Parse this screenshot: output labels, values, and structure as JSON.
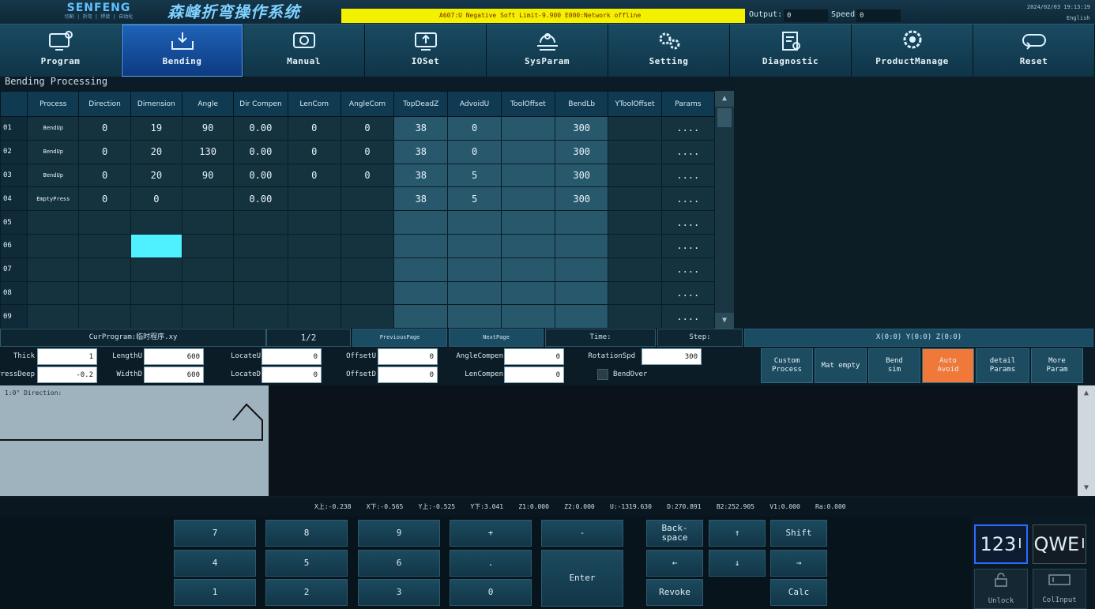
{
  "header": {
    "brand": "SENFENG",
    "brand_sub": "切割 | 折弯 | 焊接 | 自动化",
    "system_title": "森峰折弯操作系统",
    "alarm_text": "A607:U Negative Soft Limit-9.900    E000:Network offline",
    "output_label": "Output:",
    "output_value": "0",
    "speed_label": "Speed:",
    "speed_value": "0",
    "datetime": "2024/02/03 19:13:19",
    "lang": "English"
  },
  "nav": [
    {
      "label": "Program",
      "icon": "program-icon"
    },
    {
      "label": "Bending",
      "icon": "bending-icon",
      "active": true
    },
    {
      "label": "Manual",
      "icon": "manual-icon"
    },
    {
      "label": "IOSet",
      "icon": "ioset-icon"
    },
    {
      "label": "SysParam",
      "icon": "sysparam-icon"
    },
    {
      "label": "Setting",
      "icon": "setting-icon"
    },
    {
      "label": "Diagnostic",
      "icon": "diagnostic-icon"
    },
    {
      "label": "ProductManage",
      "icon": "productmanage-icon"
    },
    {
      "label": "Reset",
      "icon": "reset-icon"
    }
  ],
  "section_title": "Bending Processing",
  "table": {
    "columns": [
      "Process",
      "Direction",
      "Dimension",
      "Angle",
      "Dir Compen",
      "LenCom",
      "AngleCom",
      "TopDeadZ",
      "AdvoidU",
      "ToolOffset",
      "BendLb",
      "YToolOffset",
      "Params"
    ],
    "rows": [
      {
        "no": "01",
        "cells": [
          "BendUp",
          "0",
          "19",
          "90",
          "0.00",
          "0",
          "0",
          "38",
          "0",
          "",
          "300",
          "",
          "...."
        ]
      },
      {
        "no": "02",
        "cells": [
          "BendUp",
          "0",
          "20",
          "130",
          "0.00",
          "0",
          "0",
          "38",
          "0",
          "",
          "300",
          "",
          "...."
        ]
      },
      {
        "no": "03",
        "cells": [
          "BendUp",
          "0",
          "20",
          "90",
          "0.00",
          "0",
          "0",
          "38",
          "5",
          "",
          "300",
          "",
          "...."
        ]
      },
      {
        "no": "04",
        "cells": [
          "EmptyPress",
          "0",
          "0",
          "",
          "0.00",
          "",
          "",
          "38",
          "5",
          "",
          "300",
          "",
          "...."
        ]
      },
      {
        "no": "05",
        "cells": [
          "",
          "",
          "",
          "",
          "",
          "",
          "",
          "",
          "",
          "",
          "",
          "",
          "...."
        ]
      },
      {
        "no": "06",
        "cells": [
          "",
          "",
          "",
          "",
          "",
          "",
          "",
          "",
          "",
          "",
          "",
          "",
          "...."
        ]
      },
      {
        "no": "07",
        "cells": [
          "",
          "",
          "",
          "",
          "",
          "",
          "",
          "",
          "",
          "",
          "",
          "",
          "...."
        ]
      },
      {
        "no": "08",
        "cells": [
          "",
          "",
          "",
          "",
          "",
          "",
          "",
          "",
          "",
          "",
          "",
          "",
          "...."
        ]
      },
      {
        "no": "09",
        "cells": [
          "",
          "",
          "",
          "",
          "",
          "",
          "",
          "",
          "",
          "",
          "",
          "",
          "...."
        ]
      }
    ]
  },
  "pager": {
    "cur_program": "CurProgram:临时程序.xy",
    "page": "1/2",
    "prev": "PreviousPage",
    "next": "NextPage",
    "time": "Time:",
    "step": "Step:",
    "xyz": "X(0:0) Y(0:0) Z(0:0)"
  },
  "params": {
    "thick_label": "Thick",
    "thick_value": "1",
    "pressdeep_label": "PressDeep",
    "pressdeep_value": "-0.2",
    "lengthu_label": "LengthU",
    "lengthu_value": "600",
    "widthd_label": "WidthD",
    "widthd_value": "600",
    "locateu_label": "LocateU",
    "locateu_value": "0",
    "located_label": "LocateD",
    "located_value": "0",
    "offsetu_label": "OffsetU",
    "offsetu_value": "0",
    "offsetd_label": "OffsetD",
    "offsetd_value": "0",
    "anglecompen_label": "AngleCompen",
    "anglecompen_value": "0",
    "lencompen_label": "LenCompen",
    "lencompen_value": "0",
    "rotationspd_label": "RotationSpd",
    "rotationspd_value": "300",
    "bendover_label": "BendOver"
  },
  "func_buttons": [
    "Custom\nProcess",
    "Mat empty",
    "Bend\nsim",
    "Auto\nAvoid",
    "detail\nParams",
    "More\nParam"
  ],
  "preview_caption": "1:0° Direction:",
  "coords": "X上:-0.238    X下:-0.565    Y上:-0.525    Y下:3.041    Z1:0.000    Z2:0.000    U:-1319.630    D:270.891    B2:252.905    V1:0.000    Ra:0.000",
  "keypad": {
    "keys": [
      "7",
      "8",
      "9",
      "+",
      "-",
      "4",
      "5",
      "6",
      ".",
      "1",
      "2",
      "3",
      "0"
    ],
    "enter": "Enter",
    "backspace": "Back-\nspace",
    "up": "↑",
    "shift": "Shift",
    "left": "←",
    "down": "↓",
    "right": "→",
    "revoke": "Revoke",
    "calc": "Calc"
  },
  "kbd_modes": {
    "num": "123",
    "alpha": "QWE",
    "unlock": "Unlock",
    "colinput": "ColInput"
  },
  "colors": {
    "accent": "#1f63b8",
    "alarm": "#f3f000",
    "highlight_cell": "#4ff0ff",
    "auto_avoid": "#f07838"
  }
}
